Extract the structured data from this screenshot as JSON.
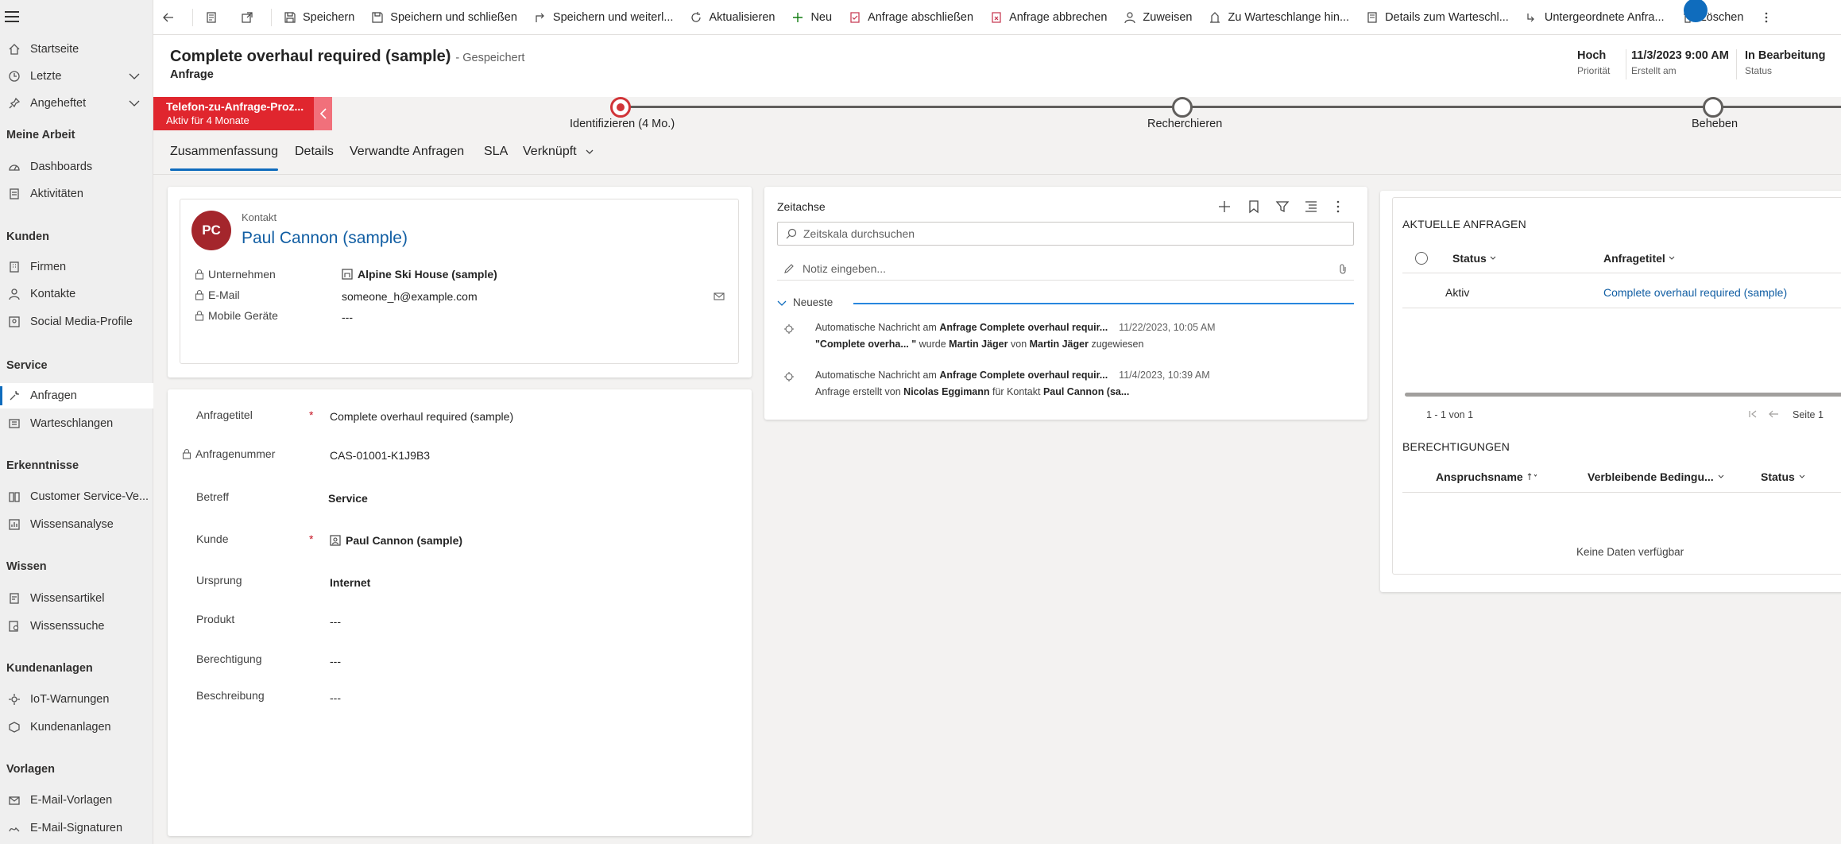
{
  "sidebar": {
    "items": [
      {
        "label": "Startseite",
        "icon": "home-icon"
      },
      {
        "label": "Letzte",
        "icon": "clock-icon"
      },
      {
        "label": "Angeheftet",
        "icon": "pin-icon"
      },
      {
        "label": "Dashboards",
        "icon": "dashboard-icon"
      },
      {
        "label": "Aktivitäten",
        "icon": "activities-icon"
      },
      {
        "label": "Firmen",
        "icon": "building-icon"
      },
      {
        "label": "Kontakte",
        "icon": "person-icon"
      },
      {
        "label": "Social Media-Profile",
        "icon": "social-profile-icon"
      },
      {
        "label": "Anfragen",
        "icon": "wrench-icon"
      },
      {
        "label": "Warteschlangen",
        "icon": "queue-icon"
      },
      {
        "label": "Customer Service-Ve...",
        "icon": "book-icon"
      },
      {
        "label": "Wissensanalyse",
        "icon": "analytics-icon"
      },
      {
        "label": "Wissensartikel",
        "icon": "article-icon"
      },
      {
        "label": "Wissenssuche",
        "icon": "search-doc-icon"
      },
      {
        "label": "IoT-Warnungen",
        "icon": "iot-icon"
      },
      {
        "label": "Kundenanlagen",
        "icon": "asset-icon"
      },
      {
        "label": "E-Mail-Vorlagen",
        "icon": "mail-template-icon"
      },
      {
        "label": "E-Mail-Signaturen",
        "icon": "signature-icon"
      }
    ],
    "groups": {
      "meine_arbeit": "Meine Arbeit",
      "kunden": "Kunden",
      "service": "Service",
      "erkenntnisse": "Erkenntnisse",
      "wissen": "Wissen",
      "kundenanlagen": "Kundenanlagen",
      "vorlagen": "Vorlagen"
    }
  },
  "commandbar": {
    "save": "Speichern",
    "save_close": "Speichern und schließen",
    "save_continue": "Speichern und weiterl...",
    "refresh": "Aktualisieren",
    "new": "Neu",
    "resolve": "Anfrage abschließen",
    "cancel": "Anfrage abbrechen",
    "assign": "Zuweisen",
    "add_queue": "Zu Warteschlange hin...",
    "queue_details": "Details zum Warteschl...",
    "child_case": "Untergeordnete Anfra...",
    "delete": "Löschen"
  },
  "header": {
    "title": "Complete overhaul required (sample)",
    "saved": "- Gespeichert",
    "entity": "Anfrage",
    "priority_value": "Hoch",
    "priority_label": "Priorität",
    "created_value": "11/3/2023 9:00 AM",
    "created_label": "Erstellt am",
    "status_value": "In Bearbeitung",
    "status_label": "Status"
  },
  "process": {
    "name": "Telefon-zu-Anfrage-Proz...",
    "active_for": "Aktiv für 4 Monate",
    "stages": [
      {
        "label": "Identifizieren  (4 Mo.)",
        "active": true
      },
      {
        "label": "Recherchieren",
        "active": false
      },
      {
        "label": "Beheben",
        "active": false
      }
    ]
  },
  "tabs": [
    {
      "label": "Zusammenfassung",
      "active": true
    },
    {
      "label": "Details"
    },
    {
      "label": "Verwandte Anfragen"
    },
    {
      "label": "SLA"
    },
    {
      "label": "Verknüpft"
    }
  ],
  "contact": {
    "type_label": "Kontakt",
    "initials": "PC",
    "name": "Paul Cannon (sample)",
    "company_label": "Unternehmen",
    "company_value": "Alpine Ski House (sample)",
    "email_label": "E-Mail",
    "email_value": "someone_h@example.com",
    "mobile_label": "Mobile Geräte",
    "mobile_value": "---"
  },
  "form": {
    "fields": [
      {
        "label": "Anfragetitel",
        "value": "Complete overhaul required (sample)",
        "required": true
      },
      {
        "label": "Anfragenummer",
        "value": "CAS-01001-K1J9B3",
        "locked": true
      },
      {
        "label": "Betreff",
        "value": "Service"
      },
      {
        "label": "Kunde",
        "value": "Paul Cannon (sample)",
        "required": true
      },
      {
        "label": "Ursprung",
        "value": "Internet"
      },
      {
        "label": "Produkt",
        "value": "---"
      },
      {
        "label": "Berechtigung",
        "value": "---"
      },
      {
        "label": "Beschreibung",
        "value": "---"
      }
    ],
    "required_mark": "*"
  },
  "timeline": {
    "title": "Zeitachse",
    "search_placeholder": "Zeitskala durchsuchen",
    "note_placeholder": "Notiz eingeben...",
    "newest": "Neueste",
    "entries": [
      {
        "pre": "Automatische Nachricht am ",
        "entity": "Anfrage Complete overhaul requir...",
        "date": "11/22/2023, 10:05 AM",
        "line2_a": "\"Complete overha... \"",
        "line2_b": " wurde ",
        "line2_c": "Martin Jäger",
        "line2_d": " von ",
        "line2_e": "Martin Jäger",
        "line2_f": " zugewiesen"
      },
      {
        "pre": "Automatische Nachricht am ",
        "entity": "Anfrage Complete overhaul requir...",
        "date": "11/4/2023, 10:39 AM",
        "line2_a": "Anfrage erstellt von ",
        "line2_b": "Nicolas Eggimann",
        "line2_c": " für Kontakt ",
        "line2_d": "Paul Cannon (sa..."
      }
    ]
  },
  "related": {
    "title": "AKTUELLE ANFRAGEN",
    "col_status": "Status",
    "col_title": "Anfragetitel",
    "rows": [
      {
        "status": "Aktiv",
        "title": "Complete overhaul required (sample)"
      }
    ],
    "paging": "1 - 1 von 1",
    "page": "Seite 1"
  },
  "entitlements": {
    "title": "BERECHTIGUNGEN",
    "col_name": "Anspruchsname",
    "col_remaining": "Verbleibende Bedingu...",
    "col_status": "Status",
    "empty": "Keine Daten verfügbar"
  },
  "colors": {
    "accent": "#0f6cbd",
    "process_red": "#e0262e",
    "avatar": "#a4262c",
    "link": "#115ea3"
  }
}
